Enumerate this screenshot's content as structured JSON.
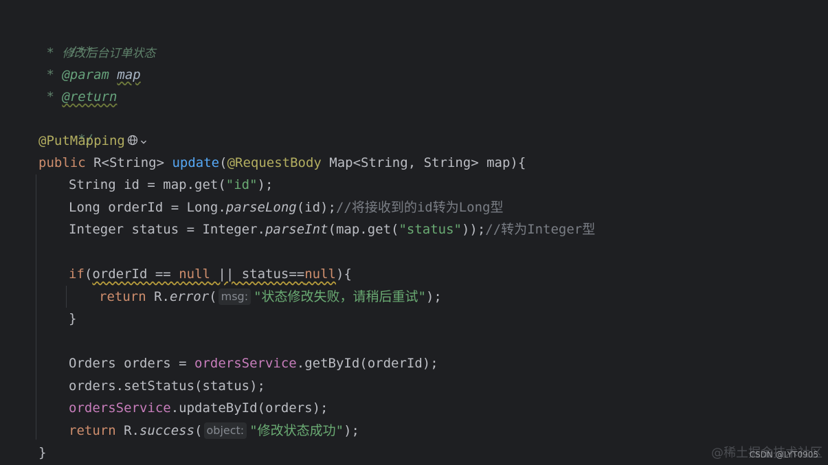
{
  "code": {
    "doc": {
      "open": "/**",
      "desc_star": " * ",
      "desc": "修改后台订单状态",
      "param_star": " * ",
      "param_tag": "@param",
      "param_name": "map",
      "return_star": " * ",
      "return_tag": "@return",
      "close": " */"
    },
    "annotation": "@PutMapping",
    "sig": {
      "public": "public",
      "ret": " R<String> ",
      "name": "update",
      "open": "(",
      "req_ann": "@RequestBody",
      "params": " Map<String, String> map){"
    },
    "l1": {
      "a": "String id = map.get(",
      "s": "\"id\"",
      "b": ");"
    },
    "l2": {
      "a": "Long orderId = Long.",
      "m": "parseLong",
      "b": "(id);",
      "c": "//将接收到的id转为Long型"
    },
    "l3": {
      "a": "Integer status = Integer.",
      "m": "parseInt",
      "b": "(map.get(",
      "s": "\"status\"",
      "d": "));",
      "c": "//转为Integer型"
    },
    "if": {
      "kw": "if",
      "a": "(",
      "w1": "orderId == ",
      "n1": "null",
      "w2": " || ",
      "w3": "status==",
      "n2": "null",
      "b": "){"
    },
    "ret_err": {
      "kw": "return",
      "a": " R.",
      "m": "error",
      "p": "(",
      "hint": "msg:",
      "s": "\"状态修改失败，请稍后重试\"",
      "b": ");"
    },
    "close_if": "}",
    "l5": {
      "a": "Orders orders = ",
      "f": "ordersService",
      "b": ".getById(orderId);"
    },
    "l6": "orders.setStatus(status);",
    "l7": {
      "f": "ordersService",
      "b": ".updateById(orders);"
    },
    "ret_ok": {
      "kw": "return",
      "a": " R.",
      "m": "success",
      "p": "(",
      "hint": "object:",
      "s": "\"修改状态成功\"",
      "b": ");"
    },
    "close_method": "}"
  },
  "icons": [
    "globe-icon",
    "chevron-down-icon"
  ],
  "watermark": "@稀土掘金技术社区",
  "csdn_mark": "CSDN @LYT0905"
}
